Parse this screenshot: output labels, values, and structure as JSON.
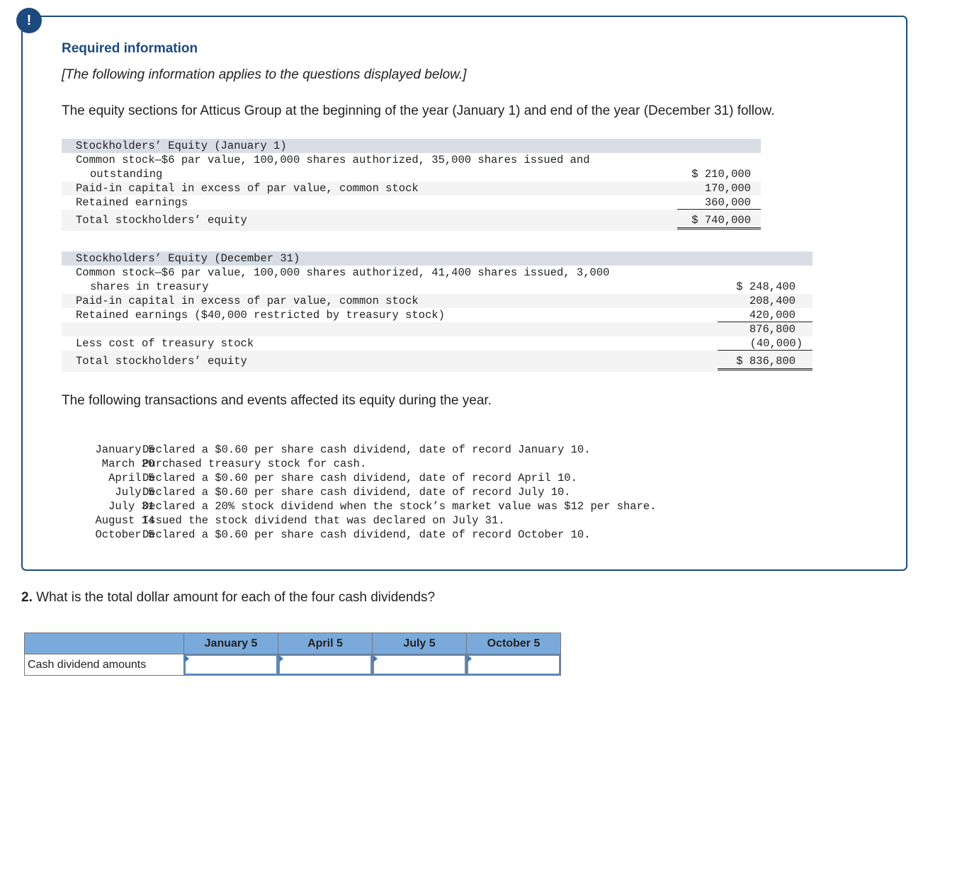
{
  "alert_icon": {
    "name": "exclamation-icon",
    "glyph": "!",
    "color": "#1d4a7e"
  },
  "required_info": {
    "title": "Required information",
    "subtitle": "[The following information applies to the questions displayed below.]",
    "intro": "The equity sections for Atticus Group at the beginning of the year (January 1) and end of the year (December 31) follow."
  },
  "equity_jan1": {
    "header": "Stockholders’ Equity (January 1)",
    "rows": [
      {
        "label": "Common stock—$6 par value, 100,000 shares authorized, 35,000 shares issued and",
        "label_cont": "outstanding",
        "amount": "$ 210,000"
      },
      {
        "label": "Paid-in capital in excess of par value, common stock",
        "amount": "170,000"
      },
      {
        "label": "Retained earnings",
        "amount": "360,000"
      },
      {
        "label": "Total stockholders’ equity",
        "amount": "$ 740,000"
      }
    ]
  },
  "equity_dec31": {
    "header": "Stockholders’ Equity (December 31)",
    "rows": [
      {
        "label": "Common stock—$6 par value, 100,000 shares authorized, 41,400 shares issued, 3,000",
        "label_cont": "shares in treasury",
        "amount": "$ 248,400"
      },
      {
        "label": "Paid-in capital in excess of par value, common stock",
        "amount": "208,400"
      },
      {
        "label": "Retained earnings ($40,000 restricted by treasury stock)",
        "amount": "420,000"
      },
      {
        "label": "",
        "amount": "876,800"
      },
      {
        "label": "Less cost of treasury stock",
        "amount": "(40,000)"
      },
      {
        "label": "Total stockholders’ equity",
        "amount": "$ 836,800"
      }
    ]
  },
  "transactions_intro": "The following transactions and events affected its equity during the year.",
  "transactions": [
    {
      "date": "January 5",
      "desc": "Declared a $0.60 per share cash dividend, date of record January 10."
    },
    {
      "date": "March 20",
      "desc": "Purchased treasury stock for cash."
    },
    {
      "date": "April 5",
      "desc": "Declared a $0.60 per share cash dividend, date of record April 10."
    },
    {
      "date": "July 5",
      "desc": "Declared a $0.60 per share cash dividend, date of record July 10."
    },
    {
      "date": "July 31",
      "desc": "Declared a 20% stock dividend when the stock’s market value was $12 per share."
    },
    {
      "date": "August 14",
      "desc": "Issued the stock dividend that was declared on July 31."
    },
    {
      "date": "October 5",
      "desc": "Declared a $0.60 per share cash dividend, date of record October 10."
    }
  ],
  "question": {
    "number": "2.",
    "text": " What is the total dollar amount for each of the four cash dividends?"
  },
  "answer_table": {
    "header_color": "#7aaadc",
    "columns": [
      "",
      "January 5",
      "April 5",
      "July 5",
      "October 5"
    ],
    "row_label": "Cash dividend amounts",
    "inputs": [
      {
        "column": "January 5",
        "value": "",
        "placeholder": ""
      },
      {
        "column": "April 5",
        "value": "",
        "placeholder": ""
      },
      {
        "column": "July 5",
        "value": "",
        "placeholder": ""
      },
      {
        "column": "October 5",
        "value": "",
        "placeholder": ""
      }
    ]
  }
}
